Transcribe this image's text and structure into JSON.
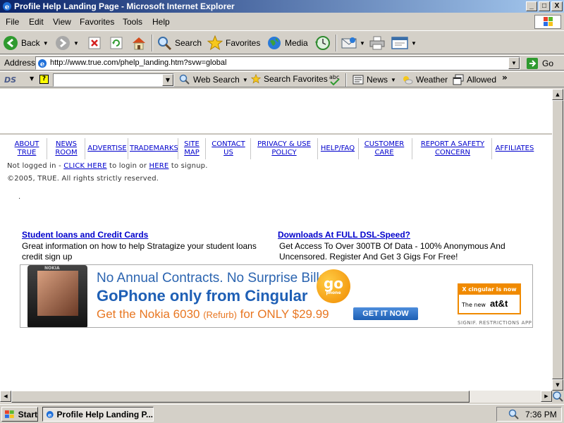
{
  "window": {
    "title": "Profile Help Landing Page - Microsoft Internet Explorer",
    "buttons": {
      "minimize": "_",
      "maximize": "□",
      "close": "X"
    }
  },
  "menu": [
    "File",
    "Edit",
    "View",
    "Favorites",
    "Tools",
    "Help"
  ],
  "toolbar": {
    "back": "Back",
    "search": "Search",
    "favorites": "Favorites",
    "media": "Media"
  },
  "address": {
    "label": "Address",
    "url": "http://www.true.com/phelp_landing.htm?svw=global",
    "go": "Go"
  },
  "links_bar": {
    "logo": "DS",
    "help": "?",
    "search_value": "",
    "web_search": "Web Search",
    "search_favorites": "Search Favorites",
    "news": "News",
    "weather": "Weather",
    "allowed": "Allowed"
  },
  "footer_nav": [
    {
      "line1": "ABOUT",
      "line2": "TRUE"
    },
    {
      "line1": "NEWS",
      "line2": "ROOM"
    },
    {
      "line1": "ADVERTISE",
      "line2": ""
    },
    {
      "line1": "TRADEMARKS",
      "line2": ""
    },
    {
      "line1": "SITE",
      "line2": "MAP"
    },
    {
      "line1": "CONTACT",
      "line2": "US"
    },
    {
      "line1": "PRIVACY & USE",
      "line2": "POLICY"
    },
    {
      "line1": "HELP/FAQ",
      "line2": ""
    },
    {
      "line1": "CUSTOMER",
      "line2": "CARE"
    },
    {
      "line1": "REPORT A SAFETY",
      "line2": "CONCERN"
    },
    {
      "line1": "AFFILIATES",
      "line2": ""
    }
  ],
  "login": {
    "prefix": "Not logged in - ",
    "click_here": "CLICK HERE",
    "middle": " to login or ",
    "here": "HERE",
    "suffix": " to signup."
  },
  "copyright": "©2005, TRUE. All rights strictly reserved.",
  "dot": ".",
  "ads": [
    {
      "title": "Student loans and Credit Cards",
      "text": "Great information on how to help Stratagize your student loans credit sign up"
    },
    {
      "title": "Downloads At FULL DSL-Speed?",
      "text": "Get Access To Over 300TB Of Data - 100% Anonymous And Uncensored. Register And Get 3 Gigs For Free!"
    }
  ],
  "banner": {
    "line1": "No Annual Contracts. No Surprise Bills.",
    "line2": "GoPhone only from Cingular",
    "line3_a": "Get the Nokia 6030 ",
    "line3_b": "(Refurb)",
    "line3_c": " for ONLY $29.99",
    "go": "go",
    "go_sub": "phone",
    "button": "GET IT NOW",
    "cingular_top": "X cingular is now",
    "cingular_new": "The new",
    "att": "at&t",
    "phone_brand": "NOKIA",
    "signif": "SIGNIF. RESTRICTIONS APPLY."
  },
  "taskbar": {
    "start": "Start",
    "task": "Profile Help Landing P...",
    "clock": "7:36 PM"
  },
  "colors": {
    "link": "#0000cc",
    "title_bar": "#0a246a",
    "chrome": "#d4d0c8"
  }
}
